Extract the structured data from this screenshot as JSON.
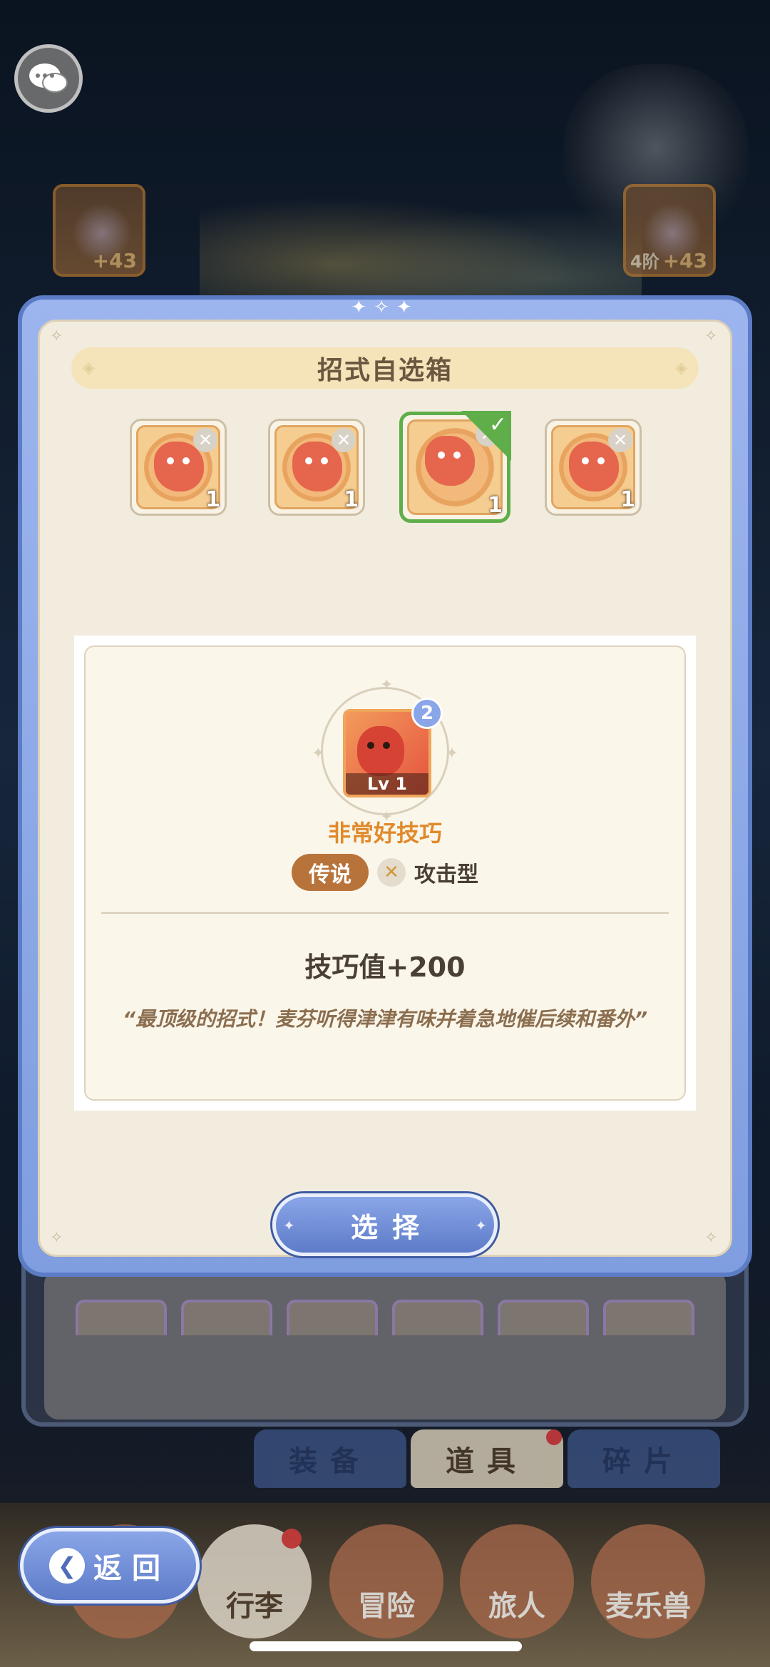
{
  "background": {
    "equipment_left": {
      "plus": "+43",
      "icon": "bow-icon"
    },
    "equipment_right": {
      "plus": "+43",
      "tier": "4阶",
      "icon": "helmet-icon"
    }
  },
  "modal": {
    "title": "招式自选箱",
    "options": [
      {
        "count": "1",
        "selected": false,
        "icon": "skill-icon-1"
      },
      {
        "count": "1",
        "selected": false,
        "icon": "skill-icon-2"
      },
      {
        "count": "1",
        "selected": true,
        "icon": "skill-icon-3"
      },
      {
        "count": "1",
        "selected": false,
        "icon": "skill-icon-4"
      }
    ],
    "detail": {
      "level": "Lv 1",
      "rank_badge": "2",
      "name": "非常好技巧",
      "rarity": "传说",
      "type": "攻击型",
      "stat": "技巧值+200",
      "quote": "“最顶级的招式！麦芬听得津津有味并着急地催后续和番外”"
    },
    "select_label": "选择"
  },
  "tabs": [
    {
      "label": "装备",
      "active": false
    },
    {
      "label": "道具",
      "active": true
    },
    {
      "label": "碎片",
      "active": false
    }
  ],
  "nav": {
    "luggage": "行李",
    "adventure": "冒险",
    "traveler": "旅人",
    "beast": "麦乐兽"
  },
  "back_label": "返回",
  "colors": {
    "accent_blue": "#7f9ee0",
    "selected_green": "#5fae49",
    "rarity_brown": "#b8733a",
    "skill_name_orange": "#e08a2c"
  }
}
